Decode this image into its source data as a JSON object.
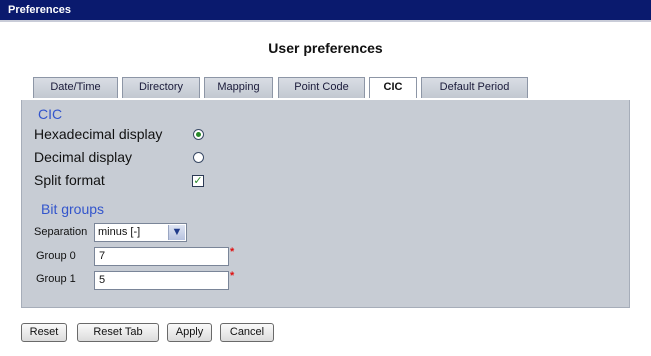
{
  "window": {
    "title": "Preferences"
  },
  "page": {
    "title": "User preferences"
  },
  "tabs": [
    {
      "label": "Date/Time"
    },
    {
      "label": "Directory"
    },
    {
      "label": "Mapping"
    },
    {
      "label": "Point Code"
    },
    {
      "label": "CIC",
      "active": true
    },
    {
      "label": "Default Period"
    }
  ],
  "cic_section": {
    "title": "CIC",
    "hex_label": "Hexadecimal display",
    "hex_selected": true,
    "dec_label": "Decimal display",
    "dec_selected": false,
    "split_label": "Split format",
    "split_checked": true
  },
  "bit_groups": {
    "title": "Bit groups",
    "separation_label": "Separation",
    "separation_value": "minus [-]",
    "group0_label": "Group 0",
    "group0_value": "7",
    "group1_label": "Group 1",
    "group1_value": "5",
    "required_mark": "*"
  },
  "buttons": {
    "reset": "Reset",
    "reset_tab": "Reset Tab",
    "apply": "Apply",
    "cancel": "Cancel"
  },
  "colors": {
    "titlebar": "#0a1a6e",
    "section_title": "#3355cc",
    "panel": "#c7ccd4",
    "required": "#e01010"
  }
}
